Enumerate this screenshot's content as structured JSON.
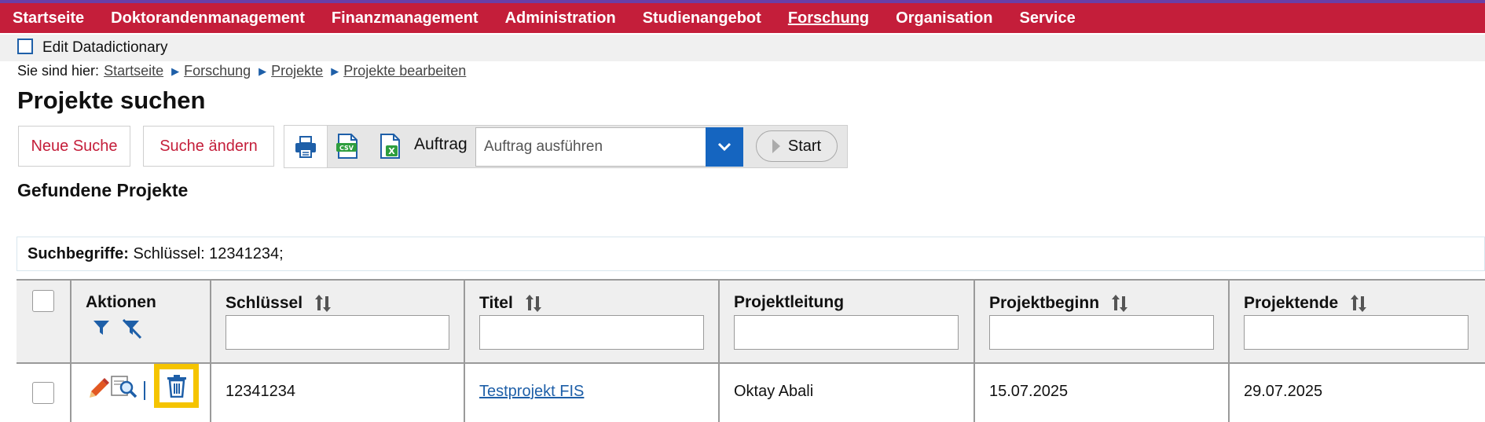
{
  "nav": {
    "items": [
      "Startseite",
      "Doktorandenmanagement",
      "Finanzmanagement",
      "Administration",
      "Studienangebot",
      "Forschung",
      "Organisation",
      "Service"
    ],
    "active": "Forschung"
  },
  "datadictionary": {
    "label": "Edit Datadictionary"
  },
  "breadcrumb": {
    "prefix": "Sie sind hier:",
    "items": [
      "Startseite",
      "Forschung",
      "Projekte",
      "Projekte bearbeiten"
    ]
  },
  "page": {
    "title": "Projekte suchen",
    "section_title": "Gefundene Projekte"
  },
  "toolbar": {
    "new_search": "Neue Suche",
    "change_search": "Suche ändern",
    "print_icon": "printer-icon",
    "csv_icon": "csv-export-icon",
    "excel_icon": "excel-export-icon",
    "auftrag_label": "Auftrag",
    "auftrag_placeholder": "Auftrag ausführen",
    "start_label": "Start"
  },
  "search_terms": {
    "label": "Suchbegriffe:",
    "value": "Schlüssel: 12341234;"
  },
  "table": {
    "headers": {
      "actions": "Aktionen",
      "key": "Schlüssel",
      "title": "Titel",
      "lead": "Projektleitung",
      "begin": "Projektbeginn",
      "end": "Projektende"
    },
    "rows": [
      {
        "key": "12341234",
        "title": "Testprojekt FIS",
        "lead": "Oktay Abali",
        "begin": "15.07.2025",
        "end": "29.07.2025"
      }
    ]
  },
  "colors": {
    "brand_red": "#c41e3a",
    "accent_blue": "#1565c0",
    "highlight_yellow": "#f5c400"
  }
}
